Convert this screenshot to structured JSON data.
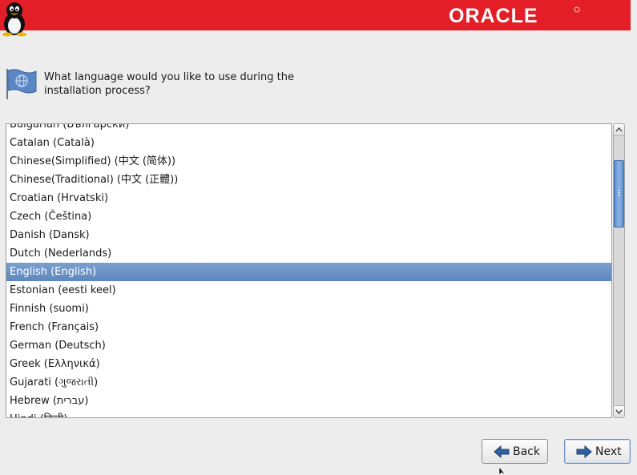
{
  "header": {
    "brand": "ORACLE",
    "brand_color": "#e31e26",
    "mascot_icon": "tux-penguin-icon"
  },
  "prompt": {
    "icon": "flag-icon",
    "text": "What language would you like to use during the installation process?"
  },
  "languages": [
    "Bulgarian (Български)",
    "Catalan (Català)",
    "Chinese(Simplified) (中文 (简体))",
    "Chinese(Traditional) (中文 (正體))",
    "Croatian (Hrvatski)",
    "Czech (Čeština)",
    "Danish (Dansk)",
    "Dutch (Nederlands)",
    "English (English)",
    "Estonian (eesti keel)",
    "Finnish (suomi)",
    "French (Français)",
    "German (Deutsch)",
    "Greek (Ελληνικά)",
    "Gujarati (ગુજરાતી)",
    "Hebrew (עברית)",
    "Hindi (हिन्दी)"
  ],
  "selected_language": "English (English)",
  "selection_color": "#6a92c6",
  "buttons": {
    "back": "Back",
    "next": "Next"
  }
}
